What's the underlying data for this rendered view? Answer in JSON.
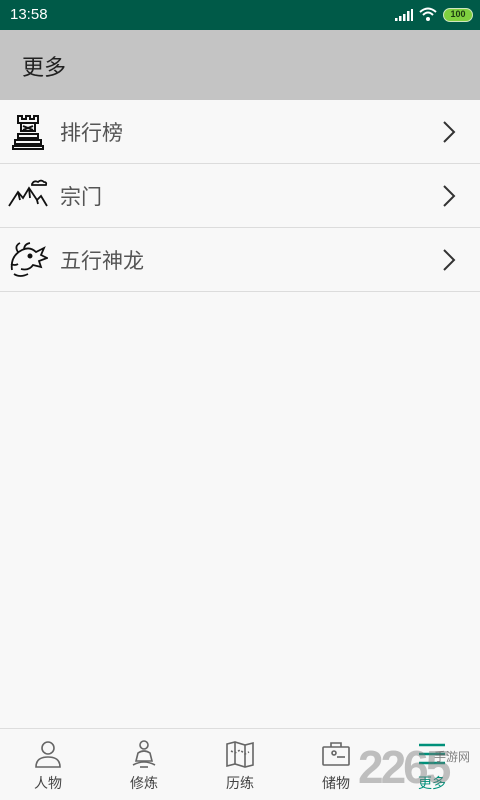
{
  "status_bar": {
    "time": "13:58",
    "battery": "100",
    "bar_color": "#005a48"
  },
  "header": {
    "title": "更多"
  },
  "menu": {
    "items": [
      {
        "label": "排行榜",
        "icon": "rook-trophy-icon"
      },
      {
        "label": "宗门",
        "icon": "mountains-clouds-icon"
      },
      {
        "label": "五行神龙",
        "icon": "dragon-head-icon"
      }
    ]
  },
  "tabbar": {
    "tabs": [
      {
        "label": "人物",
        "icon": "person-icon"
      },
      {
        "label": "修炼",
        "icon": "meditation-icon"
      },
      {
        "label": "历练",
        "icon": "map-icon"
      },
      {
        "label": "储物",
        "icon": "storage-box-icon"
      },
      {
        "label": "更多",
        "icon": "menu-lines-icon"
      }
    ],
    "active_index": 4,
    "active_color": "#00907a"
  },
  "watermark": {
    "logo": "2265",
    "text": "手游网"
  }
}
